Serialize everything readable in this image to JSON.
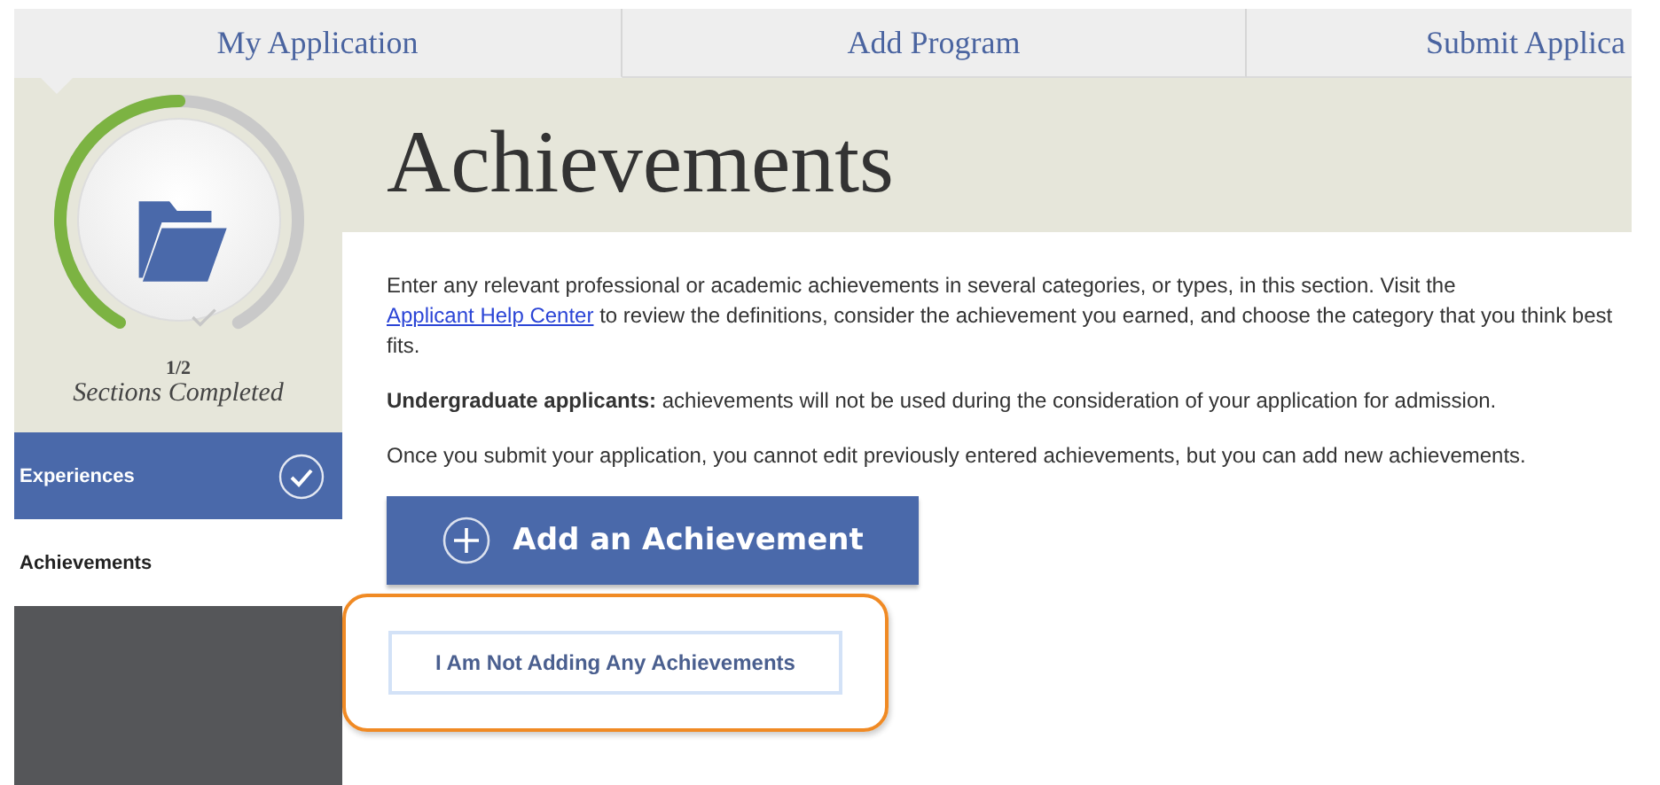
{
  "tabs": [
    {
      "label": "My Application",
      "selected": true
    },
    {
      "label": "Add Program",
      "selected": false
    },
    {
      "label": "Submit Applica",
      "selected": false
    }
  ],
  "progress": {
    "level": 0.5,
    "count": "1/2",
    "caption": "Sections Completed"
  },
  "sidebar": {
    "items": [
      {
        "label": "Experiences",
        "completed": true
      },
      {
        "label": "Achievements",
        "completed": false
      }
    ]
  },
  "page": {
    "title": "Achievements",
    "intro": {
      "before": "Enter any relevant professional or academic achievements in several categories, or types, in this section. Visit the",
      "link": "Applicant Help Center",
      "after": "to review the definitions, consider the achievement you earned, and choose the category that you think best fits."
    },
    "paragraphs": [
      "**Undergraduate applicants:** achievements will not be used during the consideration of your application for admission.",
      "Once you submit your application, you cannot edit previously entered achievements, but you can add new achievements."
    ],
    "buttons": [
      {
        "kind": "primary",
        "label": "Add an Achievement",
        "highlighted": false
      },
      {
        "kind": "secondary",
        "label": "I Am Not Adding Any Achievements",
        "highlighted": true
      }
    ]
  }
}
